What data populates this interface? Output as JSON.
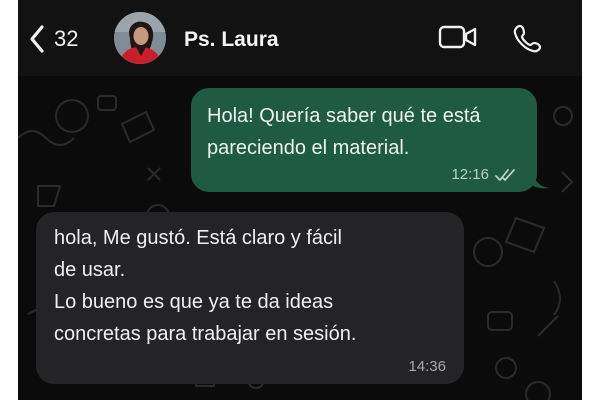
{
  "header": {
    "back_count": "32",
    "contact_name": "Ps. Laura",
    "icons": [
      "chevron-left-icon",
      "video-call-icon",
      "phone-icon"
    ]
  },
  "messages": [
    {
      "direction": "outgoing",
      "text": "Hola! Quería saber qué te está\npareciendo el material.",
      "time": "12:16",
      "status": "read"
    },
    {
      "direction": "incoming",
      "text": "hola, Me gustó. Está claro y fácil\nde usar.\nLo bueno es que ya te da ideas\nconcretas para trabajar en sesión.",
      "time": "14:36"
    }
  ],
  "colors": {
    "background": "#0b0b0b",
    "header": "#121212",
    "outgoing_bubble": "#1f5a43",
    "incoming_bubble": "#242426",
    "read_ticks": "#b8d0c7"
  }
}
